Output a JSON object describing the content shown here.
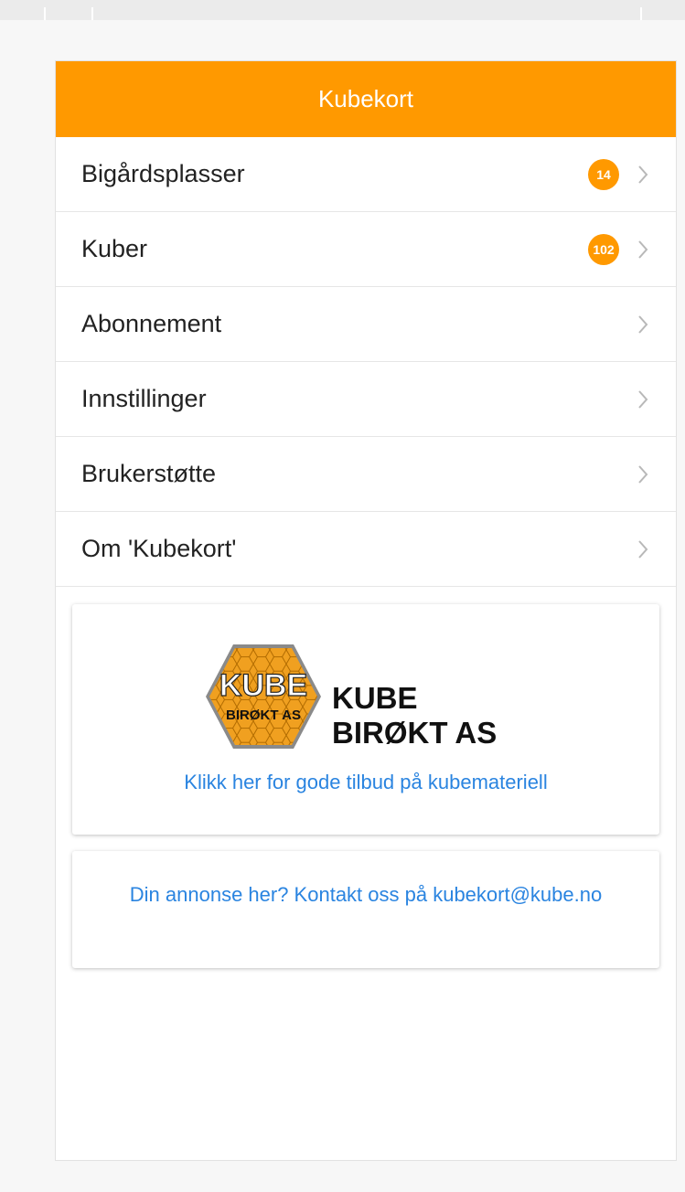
{
  "header": {
    "title": "Kubekort"
  },
  "menu": {
    "items": [
      {
        "label": "Bigårdsplasser",
        "badge": "14"
      },
      {
        "label": "Kuber",
        "badge": "102"
      },
      {
        "label": "Abonnement"
      },
      {
        "label": "Innstillinger"
      },
      {
        "label": "Brukerstøtte"
      },
      {
        "label": "Om 'Kubekort'"
      }
    ]
  },
  "ad": {
    "logo_top": "KUBE",
    "logo_bottom": "BIRØKT AS",
    "brand_name": "KUBE BIRØKT AS",
    "link_text": "Klikk her for gode tilbud på kubemateriell"
  },
  "contact": {
    "text": "Din annonse her? Kontakt oss på kubekort@kube.no"
  },
  "colors": {
    "accent": "#ff9900",
    "link": "#2a84e0",
    "text": "#222222"
  },
  "icons": {
    "chevron": "chevron-right-icon"
  }
}
